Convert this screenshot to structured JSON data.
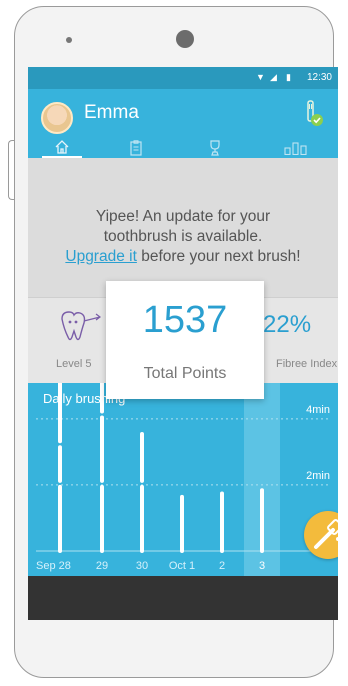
{
  "status_bar": {
    "time": "12:30",
    "icons": [
      "wifi-icon",
      "signal-icon",
      "battery-icon"
    ]
  },
  "header": {
    "username": "Emma",
    "tabs": [
      {
        "name": "home",
        "icon": "home-icon",
        "active": true
      },
      {
        "name": "clipboard",
        "icon": "clipboard-icon",
        "active": false
      },
      {
        "name": "trophy",
        "icon": "trophy-icon",
        "active": false
      },
      {
        "name": "stats",
        "icon": "bar-chart-icon",
        "active": false
      }
    ]
  },
  "update_notice": {
    "line1": "Yipee! An update for your",
    "line2": "toothbrush is available.",
    "link": "Upgrade it",
    "line3_rest": " before your next brush!"
  },
  "stats": {
    "level_label": "Level 5",
    "percent_value": "22%",
    "percent_label": "Fibree Index"
  },
  "points_card": {
    "value": "1537",
    "label": "Total Points"
  },
  "chart_data": {
    "type": "bar",
    "title": "Daily brushing",
    "categories": [
      "Sep 28",
      "29",
      "30",
      "Oct 1",
      "2",
      "3"
    ],
    "series": [
      {
        "values": [
          2,
          1.2,
          2.1
        ]
      },
      {
        "values": [
          2,
          2.1,
          2.1
        ]
      },
      {
        "values": [
          2,
          1.6,
          0
        ]
      },
      {
        "values": [
          1.7,
          0,
          0
        ]
      },
      {
        "values": [
          1.8,
          0,
          0
        ]
      },
      {
        "values": [
          1.9,
          0,
          0
        ]
      }
    ],
    "y_gridlines": [
      "2min",
      "4min"
    ],
    "ylim": [
      0,
      4.6
    ],
    "selected_index": 5
  },
  "colors": {
    "primary": "#37b3dc",
    "accent": "#2a9fd0",
    "fab": "#f3bb3c"
  }
}
